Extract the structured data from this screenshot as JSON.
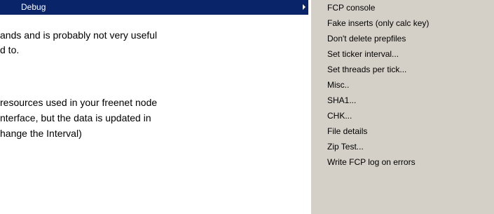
{
  "parent_menu": {
    "label": "Debug"
  },
  "document": {
    "lines": [
      "ands and is probably not very useful",
      "d to.",
      "resources used in your freenet node",
      "nterface, but the data is updated in",
      "hange the Interval)"
    ]
  },
  "submenu": {
    "items": [
      "FCP console",
      "Fake inserts (only calc key)",
      "Don't delete prepfiles",
      "Set ticker interval...",
      "Set threads per tick...",
      "Misc..",
      "SHA1...",
      "CHK...",
      "File details",
      "Zip Test...",
      "Write FCP log on errors"
    ]
  }
}
